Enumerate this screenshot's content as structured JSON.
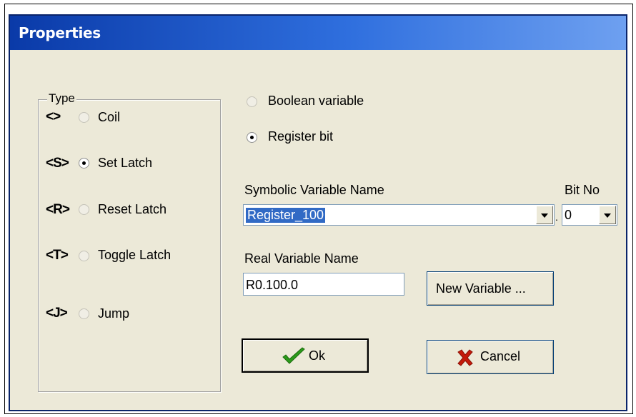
{
  "dialog": {
    "title": "Properties"
  },
  "type_group": {
    "label": "Type",
    "items": [
      {
        "glyph": "<>",
        "label": "Coil",
        "checked": false
      },
      {
        "glyph": "<S>",
        "label": "Set Latch",
        "checked": true
      },
      {
        "glyph": "<R>",
        "label": "Reset Latch",
        "checked": false
      },
      {
        "glyph": "<T>",
        "label": "Toggle Latch",
        "checked": false
      },
      {
        "glyph": "<J>",
        "label": "Jump",
        "checked": false
      }
    ]
  },
  "source": {
    "boolean_label": "Boolean variable",
    "boolean_checked": false,
    "register_label": "Register bit",
    "register_checked": true
  },
  "symbolic": {
    "label": "Symbolic Variable Name",
    "value": "Register_100"
  },
  "bitno": {
    "label": "Bit No",
    "value": "0",
    "separator": "."
  },
  "real": {
    "label": "Real Variable Name",
    "value": "R0.100.0"
  },
  "buttons": {
    "new_variable": "New Variable ...",
    "ok": "Ok",
    "cancel": "Cancel"
  },
  "icons": {
    "ok": "check-icon",
    "cancel": "x-icon"
  },
  "colors": {
    "title_start": "#0a3aa8",
    "title_end": "#6ea0f0",
    "dialog_bg": "#ece9d8",
    "selection": "#316ac5",
    "check_green": "#2a9a1a",
    "cancel_red": "#c41a0a"
  }
}
